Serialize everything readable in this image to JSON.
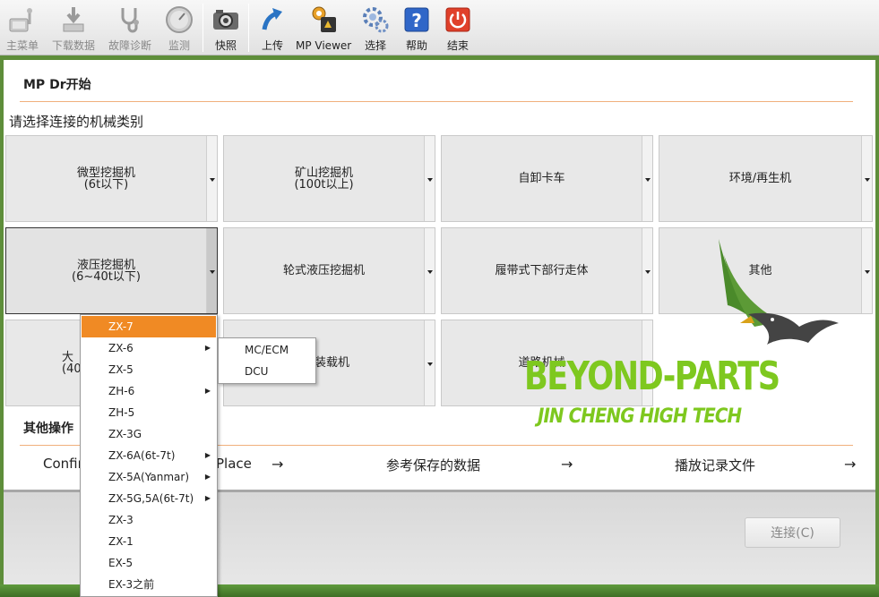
{
  "toolbar": {
    "items": [
      {
        "label": "主菜单",
        "icon": "main-menu-icon",
        "enabled": false
      },
      {
        "label": "下载数据",
        "icon": "download-data-icon",
        "enabled": false
      },
      {
        "label": "故障诊断",
        "icon": "stethoscope-icon",
        "enabled": false
      },
      {
        "label": "监测",
        "icon": "gauge-icon",
        "enabled": false
      },
      {
        "label": "快照",
        "icon": "camera-icon",
        "enabled": true
      },
      {
        "label": "上传",
        "icon": "upload-icon",
        "enabled": true
      },
      {
        "label": "MP Viewer",
        "icon": "mp-viewer-icon",
        "enabled": true
      },
      {
        "label": "选择",
        "icon": "gears-icon",
        "enabled": true
      },
      {
        "label": "帮助",
        "icon": "help-icon",
        "enabled": true
      },
      {
        "label": "结束",
        "icon": "power-icon",
        "enabled": true
      }
    ]
  },
  "main": {
    "title": "MP Dr开始",
    "prompt": "请选择连接的机械类别",
    "categories": [
      {
        "line1": "微型挖掘机",
        "line2": "(6t以下)"
      },
      {
        "line1": "矿山挖掘机",
        "line2": "(100t以上)"
      },
      {
        "line1": "自卸卡车",
        "line2": ""
      },
      {
        "line1": "环境/再生机",
        "line2": ""
      },
      {
        "line1": "液压挖掘机",
        "line2": "(6~40t以下)"
      },
      {
        "line1": "轮式液压挖掘机",
        "line2": ""
      },
      {
        "line1": "履带式下部行走体",
        "line2": ""
      },
      {
        "line1": "其他",
        "line2": ""
      },
      {
        "line1": "大",
        "line2": "(40"
      },
      {
        "line1": "装载机",
        "line2": ""
      },
      {
        "line1": "道路机械",
        "line2": ""
      }
    ]
  },
  "other_ops": {
    "title": "其他操作",
    "links": [
      "Confir",
      "Place",
      "参考保存的数据",
      "播放记录文件"
    ],
    "arrow": "→"
  },
  "dropdown": {
    "items": [
      {
        "label": "ZX-7",
        "submenu": false,
        "highlighted": true
      },
      {
        "label": "ZX-6",
        "submenu": true,
        "highlighted": false
      },
      {
        "label": "ZX-5",
        "submenu": false,
        "highlighted": false
      },
      {
        "label": "ZH-6",
        "submenu": true,
        "highlighted": false
      },
      {
        "label": "ZH-5",
        "submenu": false,
        "highlighted": false
      },
      {
        "label": "ZX-3G",
        "submenu": false,
        "highlighted": false
      },
      {
        "label": "ZX-6A(6t-7t)",
        "submenu": true,
        "highlighted": false
      },
      {
        "label": "ZX-5A(Yanmar)",
        "submenu": true,
        "highlighted": false
      },
      {
        "label": "ZX-5G,5A(6t-7t)",
        "submenu": true,
        "highlighted": false
      },
      {
        "label": "ZX-3",
        "submenu": false,
        "highlighted": false
      },
      {
        "label": "ZX-1",
        "submenu": false,
        "highlighted": false
      },
      {
        "label": "EX-5",
        "submenu": false,
        "highlighted": false
      },
      {
        "label": "EX-3之前",
        "submenu": false,
        "highlighted": false
      }
    ],
    "submenu_items": [
      "MC/ECM",
      "DCU"
    ],
    "submenu_arrow": "▶"
  },
  "footer": {
    "connect_label": "连接(C)"
  },
  "watermark": {
    "line1": "BEYOND-PARTS",
    "line2": "JIN CHENG HIGH TECH"
  },
  "colors": {
    "highlight": "#f08a24",
    "rule": "#f0b07c",
    "watermark": "#7ec81f"
  }
}
